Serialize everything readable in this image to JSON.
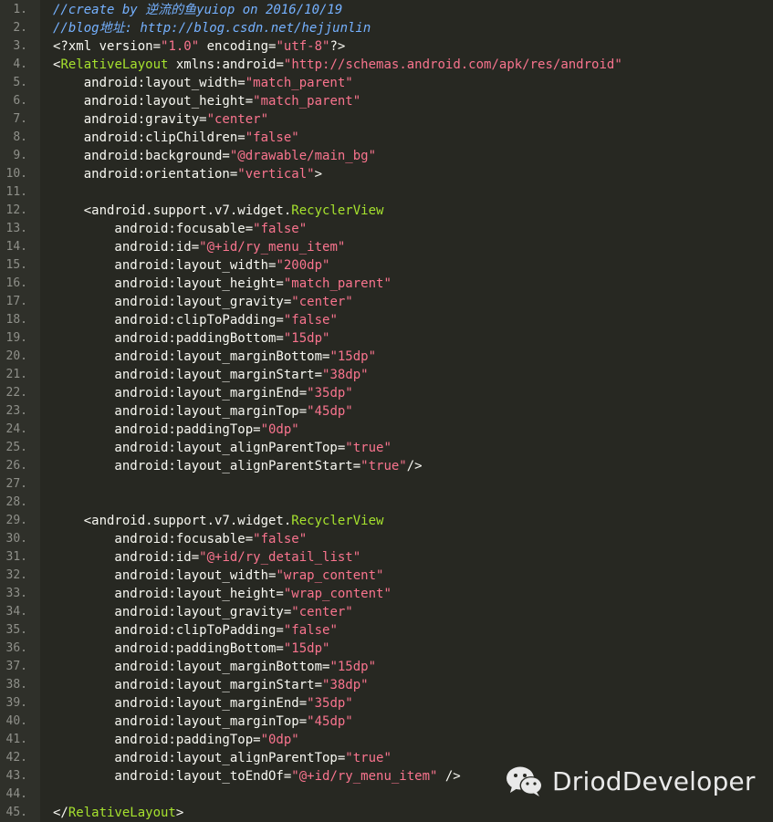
{
  "editor": {
    "lines": [
      {
        "n": "1.",
        "segs": [
          {
            "t": "//create by 逆流的鱼yuiop on 2016/10/19",
            "c": "comment"
          }
        ]
      },
      {
        "n": "2.",
        "segs": [
          {
            "t": "//blog地址: http://blog.csdn.net/hejjunlin",
            "c": "comment"
          }
        ]
      },
      {
        "n": "3.",
        "segs": [
          {
            "t": "<?xml version=",
            "c": "plain"
          },
          {
            "t": "\"1.0\"",
            "c": "str"
          },
          {
            "t": " encoding=",
            "c": "plain"
          },
          {
            "t": "\"utf-8\"",
            "c": "str"
          },
          {
            "t": "?>",
            "c": "plain"
          }
        ]
      },
      {
        "n": "4.",
        "segs": [
          {
            "t": "<",
            "c": "plain"
          },
          {
            "t": "RelativeLayout",
            "c": "tag"
          },
          {
            "t": " xmlns:android=",
            "c": "plain"
          },
          {
            "t": "\"http://schemas.android.com/apk/res/android\"",
            "c": "str"
          }
        ]
      },
      {
        "n": "5.",
        "segs": [
          {
            "t": "    android:layout_width=",
            "c": "plain"
          },
          {
            "t": "\"match_parent\"",
            "c": "str"
          }
        ]
      },
      {
        "n": "6.",
        "segs": [
          {
            "t": "    android:layout_height=",
            "c": "plain"
          },
          {
            "t": "\"match_parent\"",
            "c": "str"
          }
        ]
      },
      {
        "n": "7.",
        "segs": [
          {
            "t": "    android:gravity=",
            "c": "plain"
          },
          {
            "t": "\"center\"",
            "c": "str"
          }
        ]
      },
      {
        "n": "8.",
        "segs": [
          {
            "t": "    android:clipChildren=",
            "c": "plain"
          },
          {
            "t": "\"false\"",
            "c": "str"
          }
        ]
      },
      {
        "n": "9.",
        "segs": [
          {
            "t": "    android:background=",
            "c": "plain"
          },
          {
            "t": "\"@drawable/main_bg\"",
            "c": "str"
          }
        ]
      },
      {
        "n": "10.",
        "segs": [
          {
            "t": "    android:orientation=",
            "c": "plain"
          },
          {
            "t": "\"vertical\"",
            "c": "str"
          },
          {
            "t": ">",
            "c": "plain"
          }
        ]
      },
      {
        "n": "11.",
        "segs": []
      },
      {
        "n": "12.",
        "segs": [
          {
            "t": "    <android.support.v7.widget.",
            "c": "plain"
          },
          {
            "t": "RecyclerView",
            "c": "tag"
          }
        ]
      },
      {
        "n": "13.",
        "segs": [
          {
            "t": "        android:focusable=",
            "c": "plain"
          },
          {
            "t": "\"false\"",
            "c": "str"
          }
        ]
      },
      {
        "n": "14.",
        "segs": [
          {
            "t": "        android:id=",
            "c": "plain"
          },
          {
            "t": "\"@+id/ry_menu_item\"",
            "c": "str"
          }
        ]
      },
      {
        "n": "15.",
        "segs": [
          {
            "t": "        android:layout_width=",
            "c": "plain"
          },
          {
            "t": "\"200dp\"",
            "c": "str"
          }
        ]
      },
      {
        "n": "16.",
        "segs": [
          {
            "t": "        android:layout_height=",
            "c": "plain"
          },
          {
            "t": "\"match_parent\"",
            "c": "str"
          }
        ]
      },
      {
        "n": "17.",
        "segs": [
          {
            "t": "        android:layout_gravity=",
            "c": "plain"
          },
          {
            "t": "\"center\"",
            "c": "str"
          }
        ]
      },
      {
        "n": "18.",
        "segs": [
          {
            "t": "        android:clipToPadding=",
            "c": "plain"
          },
          {
            "t": "\"false\"",
            "c": "str"
          }
        ]
      },
      {
        "n": "19.",
        "segs": [
          {
            "t": "        android:paddingBottom=",
            "c": "plain"
          },
          {
            "t": "\"15dp\"",
            "c": "str"
          }
        ]
      },
      {
        "n": "20.",
        "segs": [
          {
            "t": "        android:layout_marginBottom=",
            "c": "plain"
          },
          {
            "t": "\"15dp\"",
            "c": "str"
          }
        ]
      },
      {
        "n": "21.",
        "segs": [
          {
            "t": "        android:layout_marginStart=",
            "c": "plain"
          },
          {
            "t": "\"38dp\"",
            "c": "str"
          }
        ]
      },
      {
        "n": "22.",
        "segs": [
          {
            "t": "        android:layout_marginEnd=",
            "c": "plain"
          },
          {
            "t": "\"35dp\"",
            "c": "str"
          }
        ]
      },
      {
        "n": "23.",
        "segs": [
          {
            "t": "        android:layout_marginTop=",
            "c": "plain"
          },
          {
            "t": "\"45dp\"",
            "c": "str"
          }
        ]
      },
      {
        "n": "24.",
        "segs": [
          {
            "t": "        android:paddingTop=",
            "c": "plain"
          },
          {
            "t": "\"0dp\"",
            "c": "str"
          }
        ]
      },
      {
        "n": "25.",
        "segs": [
          {
            "t": "        android:layout_alignParentTop=",
            "c": "plain"
          },
          {
            "t": "\"true\"",
            "c": "str"
          }
        ]
      },
      {
        "n": "26.",
        "segs": [
          {
            "t": "        android:layout_alignParentStart=",
            "c": "plain"
          },
          {
            "t": "\"true\"",
            "c": "str"
          },
          {
            "t": "/>",
            "c": "plain"
          }
        ]
      },
      {
        "n": "27.",
        "segs": []
      },
      {
        "n": "28.",
        "segs": []
      },
      {
        "n": "29.",
        "segs": [
          {
            "t": "    <android.support.v7.widget.",
            "c": "plain"
          },
          {
            "t": "RecyclerView",
            "c": "tag"
          }
        ]
      },
      {
        "n": "30.",
        "segs": [
          {
            "t": "        android:focusable=",
            "c": "plain"
          },
          {
            "t": "\"false\"",
            "c": "str"
          }
        ]
      },
      {
        "n": "31.",
        "segs": [
          {
            "t": "        android:id=",
            "c": "plain"
          },
          {
            "t": "\"@+id/ry_detail_list\"",
            "c": "str"
          }
        ]
      },
      {
        "n": "32.",
        "segs": [
          {
            "t": "        android:layout_width=",
            "c": "plain"
          },
          {
            "t": "\"wrap_content\"",
            "c": "str"
          }
        ]
      },
      {
        "n": "33.",
        "segs": [
          {
            "t": "        android:layout_height=",
            "c": "plain"
          },
          {
            "t": "\"wrap_content\"",
            "c": "str"
          }
        ]
      },
      {
        "n": "34.",
        "segs": [
          {
            "t": "        android:layout_gravity=",
            "c": "plain"
          },
          {
            "t": "\"center\"",
            "c": "str"
          }
        ]
      },
      {
        "n": "35.",
        "segs": [
          {
            "t": "        android:clipToPadding=",
            "c": "plain"
          },
          {
            "t": "\"false\"",
            "c": "str"
          }
        ]
      },
      {
        "n": "36.",
        "segs": [
          {
            "t": "        android:paddingBottom=",
            "c": "plain"
          },
          {
            "t": "\"15dp\"",
            "c": "str"
          }
        ]
      },
      {
        "n": "37.",
        "segs": [
          {
            "t": "        android:layout_marginBottom=",
            "c": "plain"
          },
          {
            "t": "\"15dp\"",
            "c": "str"
          }
        ]
      },
      {
        "n": "38.",
        "segs": [
          {
            "t": "        android:layout_marginStart=",
            "c": "plain"
          },
          {
            "t": "\"38dp\"",
            "c": "str"
          }
        ]
      },
      {
        "n": "39.",
        "segs": [
          {
            "t": "        android:layout_marginEnd=",
            "c": "plain"
          },
          {
            "t": "\"35dp\"",
            "c": "str"
          }
        ]
      },
      {
        "n": "40.",
        "segs": [
          {
            "t": "        android:layout_marginTop=",
            "c": "plain"
          },
          {
            "t": "\"45dp\"",
            "c": "str"
          }
        ]
      },
      {
        "n": "41.",
        "segs": [
          {
            "t": "        android:paddingTop=",
            "c": "plain"
          },
          {
            "t": "\"0dp\"",
            "c": "str"
          }
        ]
      },
      {
        "n": "42.",
        "segs": [
          {
            "t": "        android:layout_alignParentTop=",
            "c": "plain"
          },
          {
            "t": "\"true\"",
            "c": "str"
          }
        ]
      },
      {
        "n": "43.",
        "segs": [
          {
            "t": "        android:layout_toEndOf=",
            "c": "plain"
          },
          {
            "t": "\"@+id/ry_menu_item\"",
            "c": "str"
          },
          {
            "t": " />",
            "c": "plain"
          }
        ]
      },
      {
        "n": "44.",
        "segs": []
      },
      {
        "n": "45.",
        "segs": [
          {
            "t": "</",
            "c": "plain"
          },
          {
            "t": "RelativeLayout",
            "c": "tag"
          },
          {
            "t": ">",
            "c": "plain"
          }
        ]
      }
    ]
  },
  "watermark": {
    "text": "DriodDeveloper",
    "icon": "wechat-icon"
  },
  "colors": {
    "background": "#272822",
    "gutter": "#2f302a",
    "comment": "#75b1ff",
    "string": "#f9748e",
    "tag": "#a6e22e",
    "text": "#f8f8f2",
    "line_number": "#8f908a"
  }
}
